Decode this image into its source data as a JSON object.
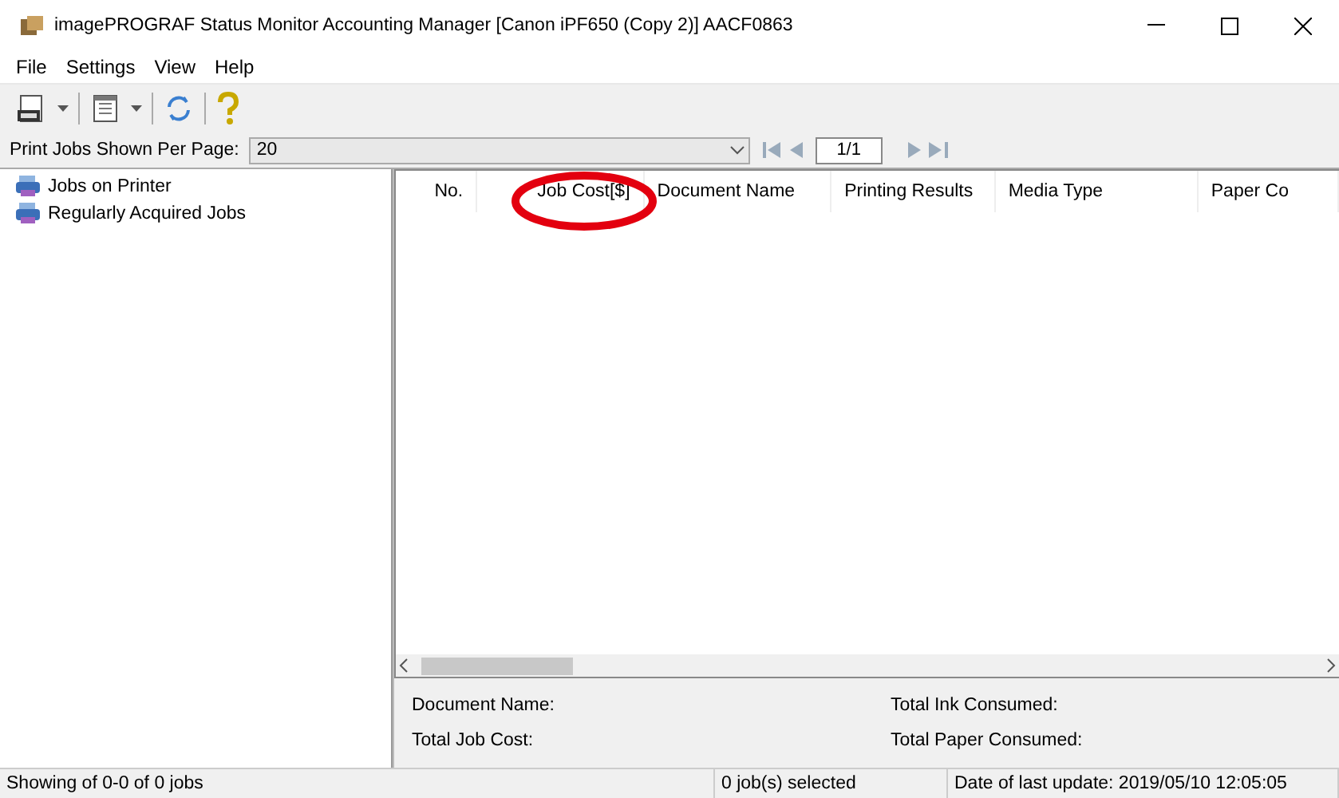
{
  "window": {
    "title": "imagePROGRAF Status Monitor Accounting Manager [Canon iPF650 (Copy 2)]  AACF0863"
  },
  "menu": [
    "File",
    "Settings",
    "View",
    "Help"
  ],
  "pager": {
    "label": "Print Jobs Shown Per Page:",
    "value": "20",
    "page": "1/1"
  },
  "tree": {
    "items": [
      {
        "label": "Jobs on Printer"
      },
      {
        "label": "Regularly Acquired Jobs"
      }
    ]
  },
  "table": {
    "columns": [
      "No.",
      "Job Cost[$]",
      "Document Name",
      "Printing Results",
      "Media Type",
      "Paper Co"
    ]
  },
  "details": [
    "Document Name:",
    "Total Ink Consumed:",
    "Total Job Cost:",
    "Total Paper Consumed:"
  ],
  "status_bar": [
    "Showing of 0-0 of 0 jobs",
    "0 job(s) selected",
    "Date of last update: 2019/05/10 12:05:05"
  ]
}
